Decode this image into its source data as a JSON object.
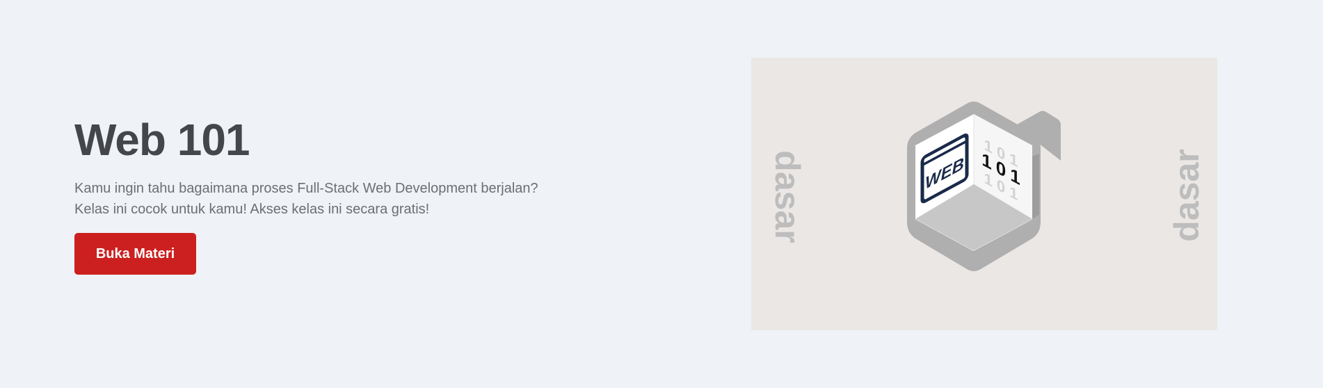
{
  "hero": {
    "title": "Web 101",
    "description_lines": [
      "Kamu ingin tahu bagaimana proses Full-Stack Web Development berjalan?",
      "Kelas ini cocok untuk kamu! Akses kelas ini secara gratis!"
    ],
    "cta_label": "Buka Materi"
  },
  "illustration": {
    "side_word_left": "dasar",
    "side_word_right": "dasar",
    "cube_label": "WEB",
    "binary_main": "101",
    "binary_faded": "101",
    "icon": "web-101-cube-icon"
  },
  "colors": {
    "page_background": "#eff2f6",
    "title_text": "#444649",
    "body_text": "#6b6f74",
    "cta_background": "#cc1f1f",
    "cta_text": "#ffffff",
    "illustration_background": "#ebe7e5",
    "side_word": "#bdbdbd",
    "cube_navy": "#1a2a4a"
  }
}
